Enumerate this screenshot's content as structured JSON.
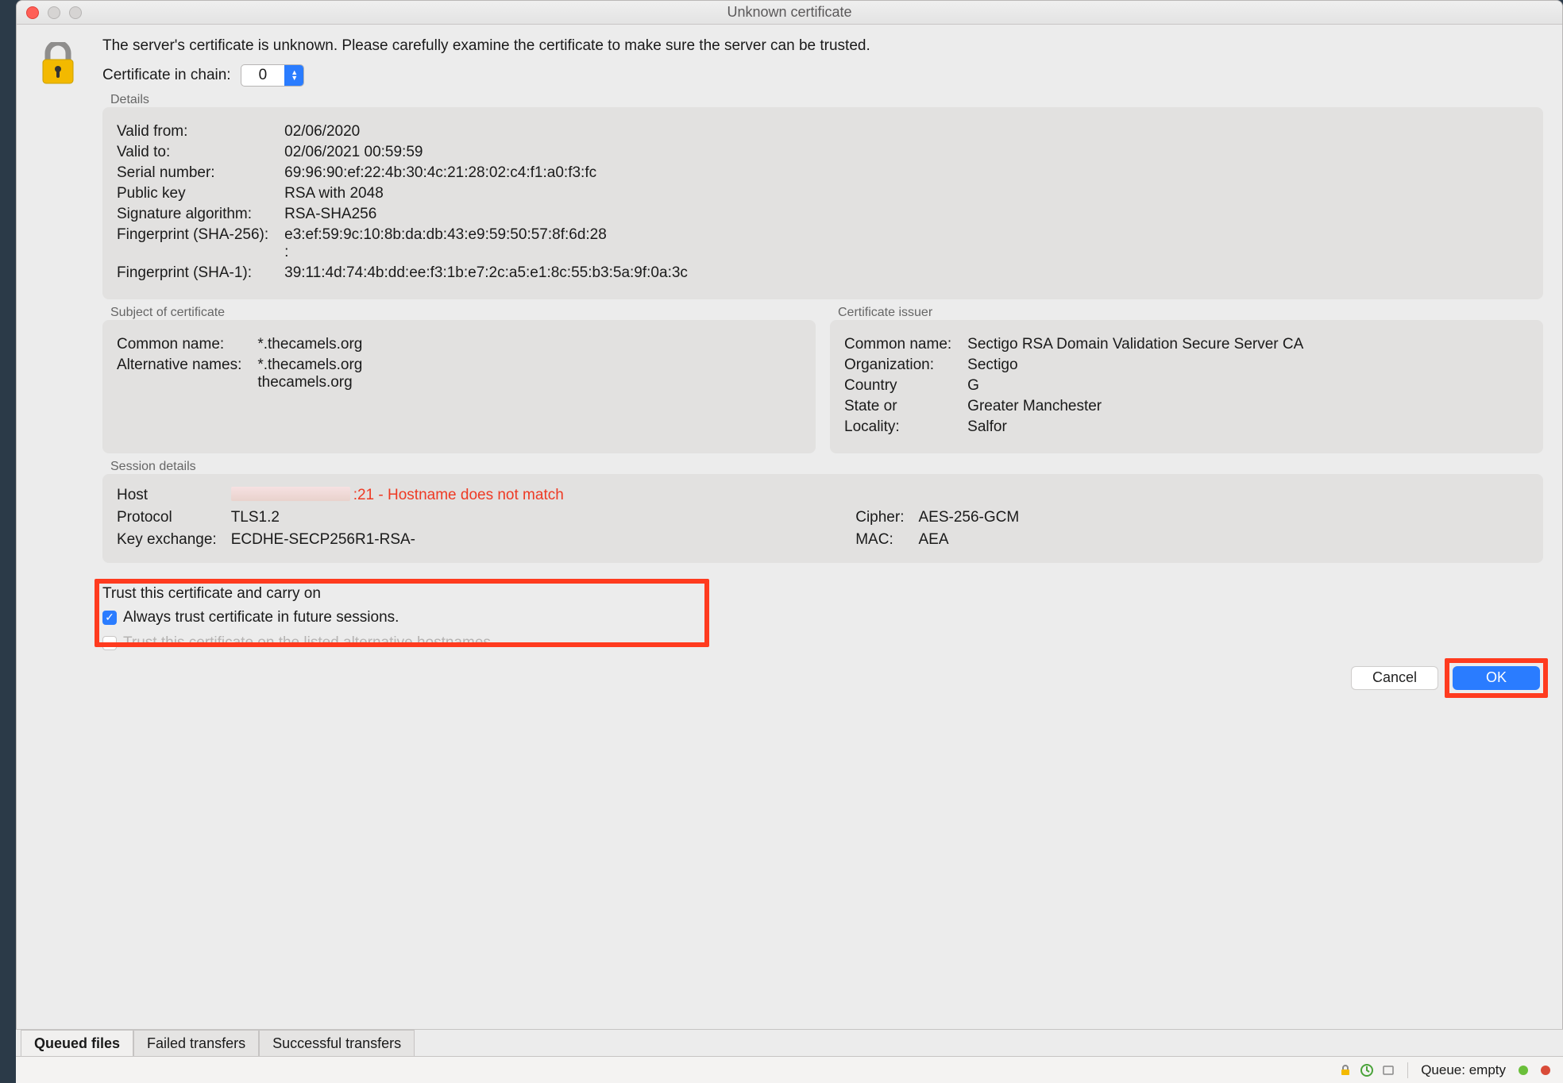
{
  "window": {
    "title": "Unknown certificate"
  },
  "intro": "The server's certificate is unknown. Please carefully examine the certificate to make sure the server can be trusted.",
  "chain": {
    "label": "Certificate in chain:",
    "value": "0"
  },
  "details": {
    "legend": "Details",
    "rows": [
      {
        "k": "Valid from:",
        "v": "02/06/2020"
      },
      {
        "k": "Valid to:",
        "v": "02/06/2021 00:59:59"
      },
      {
        "k": "Serial number:",
        "v": "69:96:90:ef:22:4b:30:4c:21:28:02:c4:f1:a0:f3:fc"
      },
      {
        "k": "Public key",
        "v": "RSA with 2048"
      },
      {
        "k": "Signature algorithm:",
        "v": "RSA-SHA256"
      },
      {
        "k": "Fingerprint (SHA-256):",
        "v": "e3:ef:59:9c:10:8b:da:db:43:e9:59:50:57:8f:6d:28\n:"
      },
      {
        "k": "Fingerprint (SHA-1):",
        "v": "39:11:4d:74:4b:dd:ee:f3:1b:e7:2c:a5:e1:8c:55:b3:5a:9f:0a:3c"
      }
    ]
  },
  "subject": {
    "legend": "Subject of certificate",
    "rows": [
      {
        "k": "Common name:",
        "v": "*.thecamels.org"
      },
      {
        "k": "Alternative names:",
        "v": "*.thecamels.org\nthecamels.org"
      }
    ]
  },
  "issuer": {
    "legend": "Certificate issuer",
    "rows": [
      {
        "k": "Common name:",
        "v": "Sectigo RSA Domain Validation Secure Server CA"
      },
      {
        "k": "Organization:",
        "v": "Sectigo"
      },
      {
        "k": "Country",
        "v": "G"
      },
      {
        "k": "State or",
        "v": "Greater Manchester"
      },
      {
        "k": "Locality:",
        "v": "Salfor"
      }
    ]
  },
  "session": {
    "legend": "Session details",
    "host_label": "Host",
    "host_suffix": ":21 - Hostname does not match",
    "rows": [
      {
        "k": "Protocol",
        "v": "TLS1.2",
        "k2": "Cipher:",
        "v2": "AES-256-GCM"
      },
      {
        "k": "Key exchange:",
        "v": "ECDHE-SECP256R1-RSA-",
        "k2": "MAC:",
        "v2": "AEA"
      }
    ]
  },
  "trust": {
    "heading": "Trust this certificate and carry on",
    "always_label": "Always trust certificate in future sessions.",
    "always_checked": true,
    "alt_label": "Trust this certificate on the listed alternative hostnames.",
    "alt_checked": false
  },
  "buttons": {
    "cancel": "Cancel",
    "ok": "OK"
  },
  "tabs": {
    "queued": "Queued files",
    "failed": "Failed transfers",
    "success": "Successful transfers"
  },
  "status": {
    "queue_label": "Queue:",
    "queue_value": "empty"
  }
}
